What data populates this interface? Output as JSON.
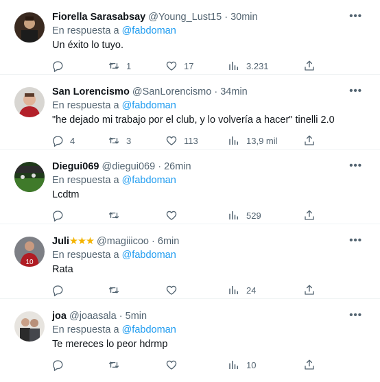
{
  "reply_prefix": "En respuesta a",
  "tweets": [
    {
      "name": "Fiorella Sarasabsay",
      "stars": "",
      "handle": "@Young_Lust15",
      "dot": "·",
      "time": "30min",
      "reply_to": "@fabdoman",
      "text": "Un éxito lo tuyo.",
      "replies": "",
      "retweets": "1",
      "likes": "17",
      "views": "3.231"
    },
    {
      "name": "San Lorencismo",
      "stars": "",
      "handle": "@SanLorencismo",
      "dot": "·",
      "time": "34min",
      "reply_to": "@fabdoman",
      "text": "\"he dejado mi trabajo por el club, y lo volvería a hacer\" tinelli 2.0",
      "replies": "4",
      "retweets": "3",
      "likes": "113",
      "views": "13,9 mil"
    },
    {
      "name": "Diegui069",
      "stars": "",
      "handle": "@diegui069",
      "dot": "·",
      "time": "26min",
      "reply_to": "@fabdoman",
      "text": "Lcdtm",
      "replies": "",
      "retweets": "",
      "likes": "",
      "views": "529"
    },
    {
      "name": "Juli",
      "stars": "★★★",
      "handle": "@magiiicoo",
      "dot": "·",
      "time": "6min",
      "reply_to": "@fabdoman",
      "text": "Rata",
      "replies": "",
      "retweets": "",
      "likes": "",
      "views": "24"
    },
    {
      "name": "joa",
      "stars": "",
      "handle": "@joaasala",
      "dot": "·",
      "time": "5min",
      "reply_to": "@fabdoman",
      "text": "Te mereces lo peor hdrmp",
      "replies": "",
      "retweets": "",
      "likes": "",
      "views": "10"
    }
  ],
  "icons": {
    "reply": "reply-icon",
    "retweet": "retweet-icon",
    "like": "heart-icon",
    "views": "views-icon",
    "share": "share-icon",
    "more": "more-icon"
  },
  "colors": {
    "text": "#0f1419",
    "secondary": "#536471",
    "link": "#1d9bf0",
    "star": "#f4b400",
    "divider": "#eff3f4"
  }
}
